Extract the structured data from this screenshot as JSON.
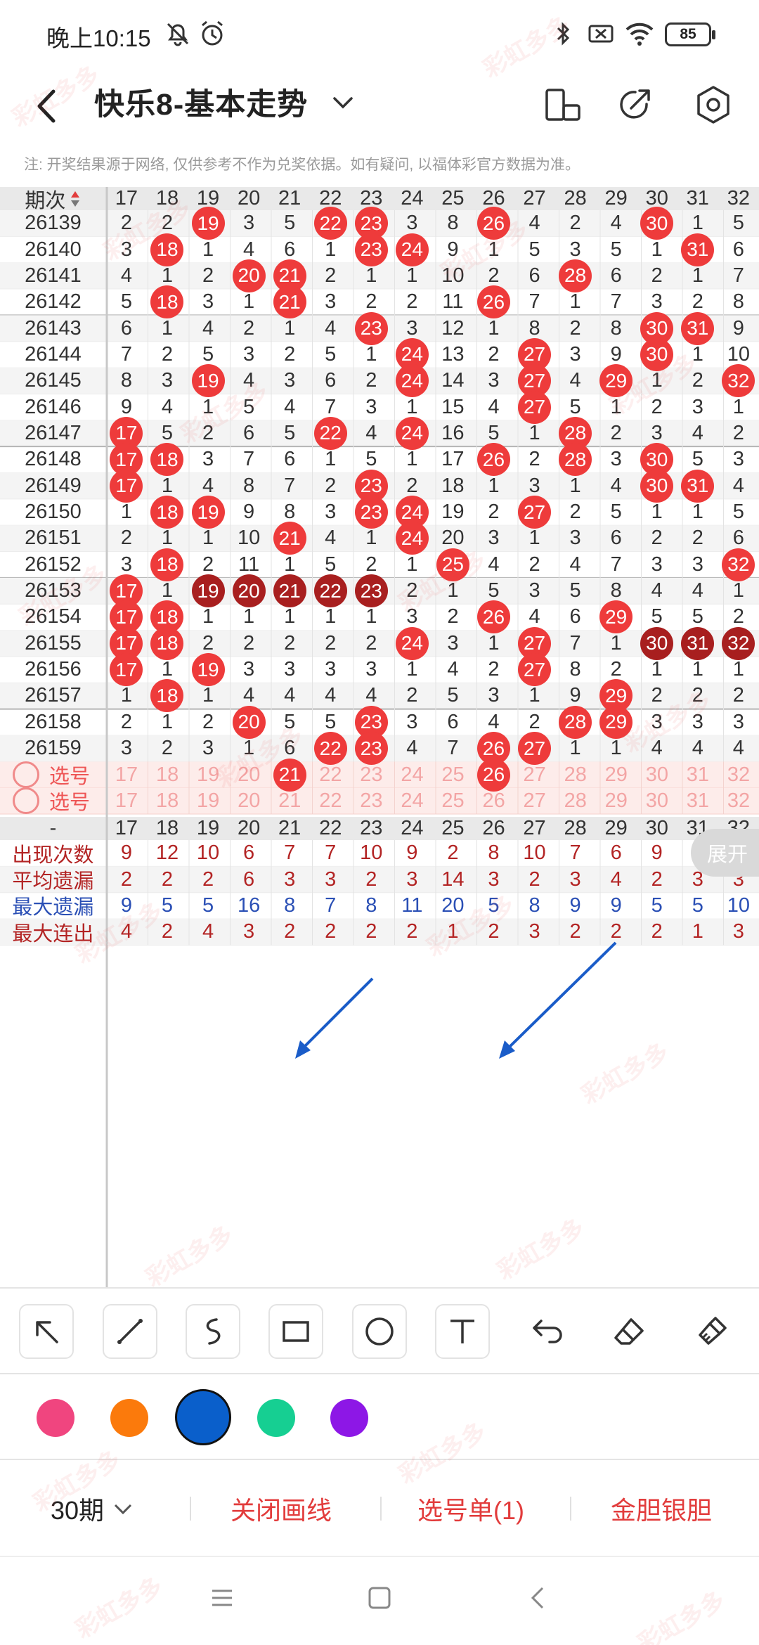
{
  "status": {
    "time": "晚上10:15",
    "battery": "85"
  },
  "header": {
    "title": "快乐8-基本走势"
  },
  "notice": "注: 开奖结果源于网络, 仅供参考不作为兑奖依据。如有疑问, 以福体彩官方数据为准。",
  "table": {
    "id_header": "期次",
    "columns": [
      "17",
      "18",
      "19",
      "20",
      "21",
      "22",
      "23",
      "24",
      "25",
      "26",
      "27",
      "28",
      "29",
      "30",
      "31",
      "32"
    ],
    "rows": [
      {
        "id": "26139",
        "cells": [
          "2",
          "2",
          "19",
          "3",
          "5",
          "22",
          "23",
          "3",
          "8",
          "26",
          "4",
          "2",
          "4",
          "30",
          "1",
          "5"
        ],
        "hits": [
          2,
          5,
          6,
          9,
          13
        ]
      },
      {
        "id": "26140",
        "cells": [
          "3",
          "18",
          "1",
          "4",
          "6",
          "1",
          "23",
          "24",
          "9",
          "1",
          "5",
          "3",
          "5",
          "1",
          "31",
          "6"
        ],
        "hits": [
          1,
          6,
          7,
          14
        ]
      },
      {
        "id": "26141",
        "cells": [
          "4",
          "1",
          "2",
          "20",
          "21",
          "2",
          "1",
          "1",
          "10",
          "2",
          "6",
          "28",
          "6",
          "2",
          "1",
          "7"
        ],
        "hits": [
          3,
          4,
          11
        ]
      },
      {
        "id": "26142",
        "cells": [
          "5",
          "18",
          "3",
          "1",
          "21",
          "3",
          "2",
          "2",
          "11",
          "26",
          "7",
          "1",
          "7",
          "3",
          "2",
          "8"
        ],
        "hits": [
          1,
          4,
          9
        ]
      },
      {
        "id": "26143",
        "cells": [
          "6",
          "1",
          "4",
          "2",
          "1",
          "4",
          "23",
          "3",
          "12",
          "1",
          "8",
          "2",
          "8",
          "30",
          "31",
          "9"
        ],
        "hits": [
          6,
          13,
          14
        ]
      },
      {
        "id": "26144",
        "cells": [
          "7",
          "2",
          "5",
          "3",
          "2",
          "5",
          "1",
          "24",
          "13",
          "2",
          "27",
          "3",
          "9",
          "30",
          "1",
          "10"
        ],
        "hits": [
          7,
          10,
          13
        ]
      },
      {
        "id": "26145",
        "cells": [
          "8",
          "3",
          "19",
          "4",
          "3",
          "6",
          "2",
          "24",
          "14",
          "3",
          "27",
          "4",
          "29",
          "1",
          "2",
          "32"
        ],
        "hits": [
          2,
          7,
          10,
          12,
          15
        ]
      },
      {
        "id": "26146",
        "cells": [
          "9",
          "4",
          "1",
          "5",
          "4",
          "7",
          "3",
          "1",
          "15",
          "4",
          "27",
          "5",
          "1",
          "2",
          "3",
          "1"
        ],
        "hits": [
          10
        ]
      },
      {
        "id": "26147",
        "cells": [
          "17",
          "5",
          "2",
          "6",
          "5",
          "22",
          "4",
          "24",
          "16",
          "5",
          "1",
          "28",
          "2",
          "3",
          "4",
          "2"
        ],
        "hits": [
          0,
          5,
          7,
          11
        ]
      },
      {
        "id": "26148",
        "cells": [
          "17",
          "18",
          "3",
          "7",
          "6",
          "1",
          "5",
          "1",
          "17",
          "26",
          "2",
          "28",
          "3",
          "30",
          "5",
          "3"
        ],
        "hits": [
          0,
          1,
          9,
          11,
          13
        ]
      },
      {
        "id": "26149",
        "cells": [
          "17",
          "1",
          "4",
          "8",
          "7",
          "2",
          "23",
          "2",
          "18",
          "1",
          "3",
          "1",
          "4",
          "30",
          "31",
          "4"
        ],
        "hits": [
          0,
          6,
          13,
          14
        ]
      },
      {
        "id": "26150",
        "cells": [
          "1",
          "18",
          "19",
          "9",
          "8",
          "3",
          "23",
          "24",
          "19",
          "2",
          "27",
          "2",
          "5",
          "1",
          "1",
          "5"
        ],
        "hits": [
          1,
          2,
          6,
          7,
          10
        ]
      },
      {
        "id": "26151",
        "cells": [
          "2",
          "1",
          "1",
          "10",
          "21",
          "4",
          "1",
          "24",
          "20",
          "3",
          "1",
          "3",
          "6",
          "2",
          "2",
          "6"
        ],
        "hits": [
          4,
          7
        ]
      },
      {
        "id": "26152",
        "cells": [
          "3",
          "18",
          "2",
          "11",
          "1",
          "5",
          "2",
          "1",
          "25",
          "4",
          "2",
          "4",
          "7",
          "3",
          "3",
          "32"
        ],
        "hits": [
          1,
          8,
          15
        ]
      },
      {
        "id": "26153",
        "cells": [
          "17",
          "1",
          "19",
          "20",
          "21",
          "22",
          "23",
          "2",
          "1",
          "5",
          "3",
          "5",
          "8",
          "4",
          "4",
          "1"
        ],
        "hits": [
          0
        ],
        "dark": [
          2,
          3,
          4,
          5,
          6
        ]
      },
      {
        "id": "26154",
        "cells": [
          "17",
          "18",
          "1",
          "1",
          "1",
          "1",
          "1",
          "3",
          "2",
          "26",
          "4",
          "6",
          "29",
          "5",
          "5",
          "2"
        ],
        "hits": [
          0,
          1,
          9,
          12
        ]
      },
      {
        "id": "26155",
        "cells": [
          "17",
          "18",
          "2",
          "2",
          "2",
          "2",
          "2",
          "24",
          "3",
          "1",
          "27",
          "7",
          "1",
          "30",
          "31",
          "32"
        ],
        "hits": [
          0,
          1,
          7,
          10
        ],
        "dark": [
          13,
          14,
          15
        ]
      },
      {
        "id": "26156",
        "cells": [
          "17",
          "1",
          "19",
          "3",
          "3",
          "3",
          "3",
          "1",
          "4",
          "2",
          "27",
          "8",
          "2",
          "1",
          "1",
          "1"
        ],
        "hits": [
          0,
          2,
          10
        ]
      },
      {
        "id": "26157",
        "cells": [
          "1",
          "18",
          "1",
          "4",
          "4",
          "4",
          "4",
          "2",
          "5",
          "3",
          "1",
          "9",
          "29",
          "2",
          "2",
          "2"
        ],
        "hits": [
          1,
          12
        ]
      },
      {
        "id": "26158",
        "cells": [
          "2",
          "1",
          "2",
          "20",
          "5",
          "5",
          "23",
          "3",
          "6",
          "4",
          "2",
          "28",
          "29",
          "3",
          "3",
          "3"
        ],
        "hits": [
          3,
          6,
          11,
          12
        ]
      },
      {
        "id": "26159",
        "cells": [
          "3",
          "2",
          "3",
          "1",
          "6",
          "22",
          "23",
          "4",
          "7",
          "26",
          "27",
          "1",
          "1",
          "4",
          "4",
          "4"
        ],
        "hits": [
          5,
          6,
          9,
          10
        ]
      }
    ],
    "pick_rows": [
      {
        "label": "选号",
        "cells": [
          "17",
          "18",
          "19",
          "20",
          "21",
          "22",
          "23",
          "24",
          "25",
          "26",
          "27",
          "28",
          "29",
          "30",
          "31",
          "32"
        ],
        "hits": [
          4,
          9
        ]
      },
      {
        "label": "选号",
        "cells": [
          "17",
          "18",
          "19",
          "20",
          "21",
          "22",
          "23",
          "24",
          "25",
          "26",
          "27",
          "28",
          "29",
          "30",
          "31",
          "32"
        ],
        "hits": []
      }
    ],
    "footer_header": {
      "id": "-",
      "cells": [
        "17",
        "18",
        "19",
        "20",
        "21",
        "22",
        "23",
        "24",
        "25",
        "26",
        "27",
        "28",
        "29",
        "30",
        "31",
        "32"
      ]
    },
    "stats": [
      {
        "label": "出现次数",
        "tone": "red",
        "cells": [
          "9",
          "12",
          "10",
          "6",
          "7",
          "7",
          "10",
          "9",
          "2",
          "8",
          "10",
          "7",
          "6",
          "9",
          "",
          "3"
        ]
      },
      {
        "label": "平均遗漏",
        "tone": "red",
        "cells": [
          "2",
          "2",
          "2",
          "6",
          "3",
          "3",
          "2",
          "3",
          "14",
          "3",
          "2",
          "3",
          "4",
          "2",
          "3",
          "3"
        ]
      },
      {
        "label": "最大遗漏",
        "tone": "blue",
        "cells": [
          "9",
          "5",
          "5",
          "16",
          "8",
          "7",
          "8",
          "11",
          "20",
          "5",
          "8",
          "9",
          "9",
          "5",
          "5",
          "10"
        ]
      },
      {
        "label": "最大连出",
        "tone": "red",
        "cells": [
          "4",
          "2",
          "4",
          "3",
          "2",
          "2",
          "2",
          "2",
          "1",
          "2",
          "3",
          "2",
          "2",
          "2",
          "1",
          "3"
        ]
      }
    ],
    "expand_label": "展开"
  },
  "palette": [
    "#f0457f",
    "#fb7a0c",
    "#0a5fcb",
    "#16cf92",
    "#8d17e6"
  ],
  "bottom": {
    "period": "30期",
    "close_lines": "关闭画线",
    "pick_list": "选号单(1)",
    "golden": "金胆银胆"
  },
  "watermark": "彩虹多多"
}
